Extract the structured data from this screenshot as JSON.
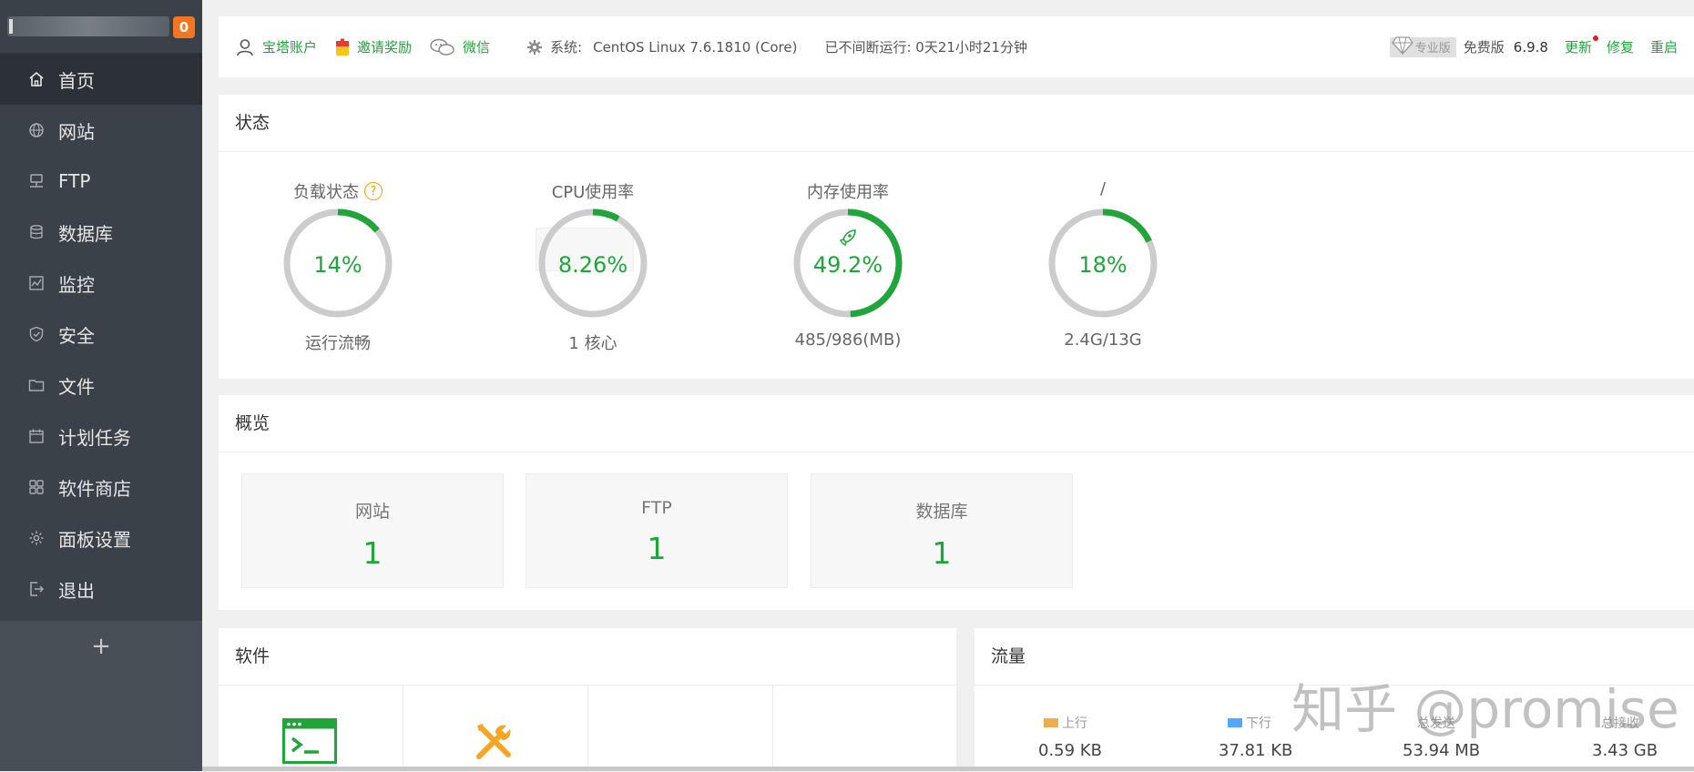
{
  "sidebar": {
    "badge": "0",
    "items": [
      {
        "label": "首页",
        "icon": "home-icon"
      },
      {
        "label": "网站",
        "icon": "globe-icon"
      },
      {
        "label": "FTP",
        "icon": "ftp-icon"
      },
      {
        "label": "数据库",
        "icon": "database-icon"
      },
      {
        "label": "监控",
        "icon": "monitor-icon"
      },
      {
        "label": "安全",
        "icon": "shield-icon"
      },
      {
        "label": "文件",
        "icon": "folder-icon"
      },
      {
        "label": "计划任务",
        "icon": "calendar-icon"
      },
      {
        "label": "软件商店",
        "icon": "grid-icon"
      },
      {
        "label": "面板设置",
        "icon": "gear-icon"
      },
      {
        "label": "退出",
        "icon": "logout-icon"
      }
    ],
    "add_label": "+"
  },
  "header": {
    "account": "宝塔账户",
    "invite": "邀请奖励",
    "wechat": "微信",
    "system_label": "系统:",
    "system_value": "CentOS Linux 7.6.1810 (Core)",
    "uptime": "已不间断运行: 0天21小时21分钟",
    "pro_tag": "专业版",
    "edition": "免费版",
    "version": "6.9.8",
    "update": "更新",
    "repair": "修复",
    "restart": "重启"
  },
  "status": {
    "title": "状态",
    "gauges": [
      {
        "title": "负载状态",
        "value": "14%",
        "percent": 14,
        "sub": "运行流畅",
        "help": "?"
      },
      {
        "title": "CPU使用率",
        "value": "8.26%",
        "percent": 8.26,
        "sub": "1 核心"
      },
      {
        "title": "内存使用率",
        "value": "49.2%",
        "percent": 49.2,
        "sub": "485/986(MB)"
      },
      {
        "title": "/",
        "value": "18%",
        "percent": 18,
        "sub": "2.4G/13G"
      }
    ]
  },
  "overview": {
    "title": "概览",
    "cards": [
      {
        "label": "网站",
        "value": "1"
      },
      {
        "label": "FTP",
        "value": "1"
      },
      {
        "label": "数据库",
        "value": "1"
      }
    ]
  },
  "software": {
    "title": "软件"
  },
  "traffic": {
    "title": "流量",
    "items": [
      {
        "label": "上行",
        "value": "0.59 KB",
        "color": "#f0ad4e"
      },
      {
        "label": "下行",
        "value": "37.81 KB",
        "color": "#52a9ff"
      },
      {
        "label": "总发送",
        "value": "53.94 MB"
      },
      {
        "label": "总接收",
        "value": "3.43 GB"
      }
    ]
  },
  "watermark": "知乎 @promise",
  "colors": {
    "accent": "#20a53a",
    "sidebar": "#3a4149",
    "badge": "#f5761f"
  }
}
